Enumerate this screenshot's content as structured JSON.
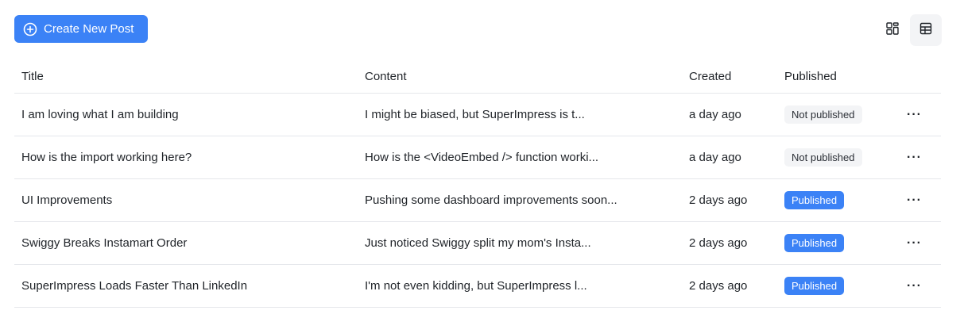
{
  "toolbar": {
    "create_label": "Create New Post",
    "create_icon": "plus-circle-icon",
    "view_grid_icon": "grid-view-icon",
    "view_table_icon": "table-view-icon",
    "active_view": "table"
  },
  "table": {
    "headers": {
      "title": "Title",
      "content": "Content",
      "created": "Created",
      "published": "Published"
    },
    "rows": [
      {
        "title": "I am loving what I am building",
        "content": "I might be biased, but SuperImpress is t...",
        "created": "a day ago",
        "status": "Not published"
      },
      {
        "title": "How is the import working here?",
        "content": "How is the <VideoEmbed /> function worki...",
        "created": "a day ago",
        "status": "Not published"
      },
      {
        "title": "UI Improvements",
        "content": "Pushing some dashboard improvements soon...",
        "created": "2 days ago",
        "status": "Published"
      },
      {
        "title": "Swiggy Breaks Instamart Order",
        "content": "Just noticed Swiggy split my mom's Insta...",
        "created": "2 days ago",
        "status": "Published"
      },
      {
        "title": "SuperImpress Loads Faster Than LinkedIn",
        "content": "I'm not even kidding, but SuperImpress l...",
        "created": "2 days ago",
        "status": "Published"
      }
    ],
    "actions_label": "···"
  },
  "colors": {
    "accent": "#3b82f6",
    "badge_muted": "#f3f4f6",
    "divider": "#e5e7eb"
  }
}
